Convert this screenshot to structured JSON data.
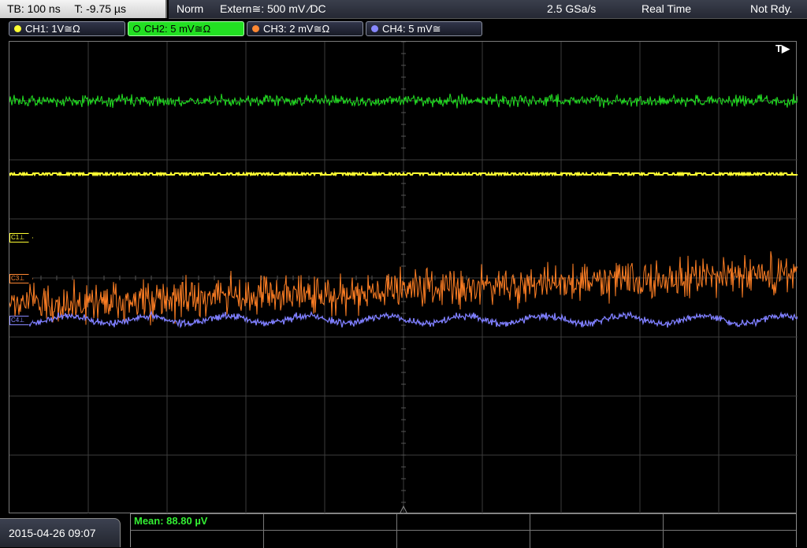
{
  "timebase": {
    "tb": "TB: 100 ns",
    "t": "T: -9.75 µs"
  },
  "status": {
    "mode": "Norm",
    "trigger": "Extern≅: 500 mV ⁄DC",
    "sample_rate": "2.5 GSa/s",
    "acq": "Real Time",
    "state": "Not Rdy."
  },
  "channels": [
    {
      "label": "CH1: 1V≅Ω",
      "color": "#ffff33",
      "active": false
    },
    {
      "label": "CH2: 5 mV≅Ω",
      "color": "#22e022",
      "active": true
    },
    {
      "label": "CH3: 2 mV≅Ω",
      "color": "#ff8833",
      "active": false
    },
    {
      "label": "CH4: 5 mV≅",
      "color": "#8888ff",
      "active": false
    }
  ],
  "trigger_marker": "T▶",
  "markers": [
    {
      "label": "C1⊥",
      "color": "#ffff33"
    },
    {
      "label": "C3⊥",
      "color": "#ff8833"
    },
    {
      "label": "C4⊥",
      "color": "#8888ff"
    }
  ],
  "measurement": {
    "mean": "Mean: 88.80 µV"
  },
  "datetime": "2015-04-26 09:07",
  "colors": {
    "ch1": "#ffff33",
    "ch2": "#22e022",
    "ch3": "#ff7f24",
    "ch4": "#7f7fff",
    "grid": "#3c3c3c"
  }
}
